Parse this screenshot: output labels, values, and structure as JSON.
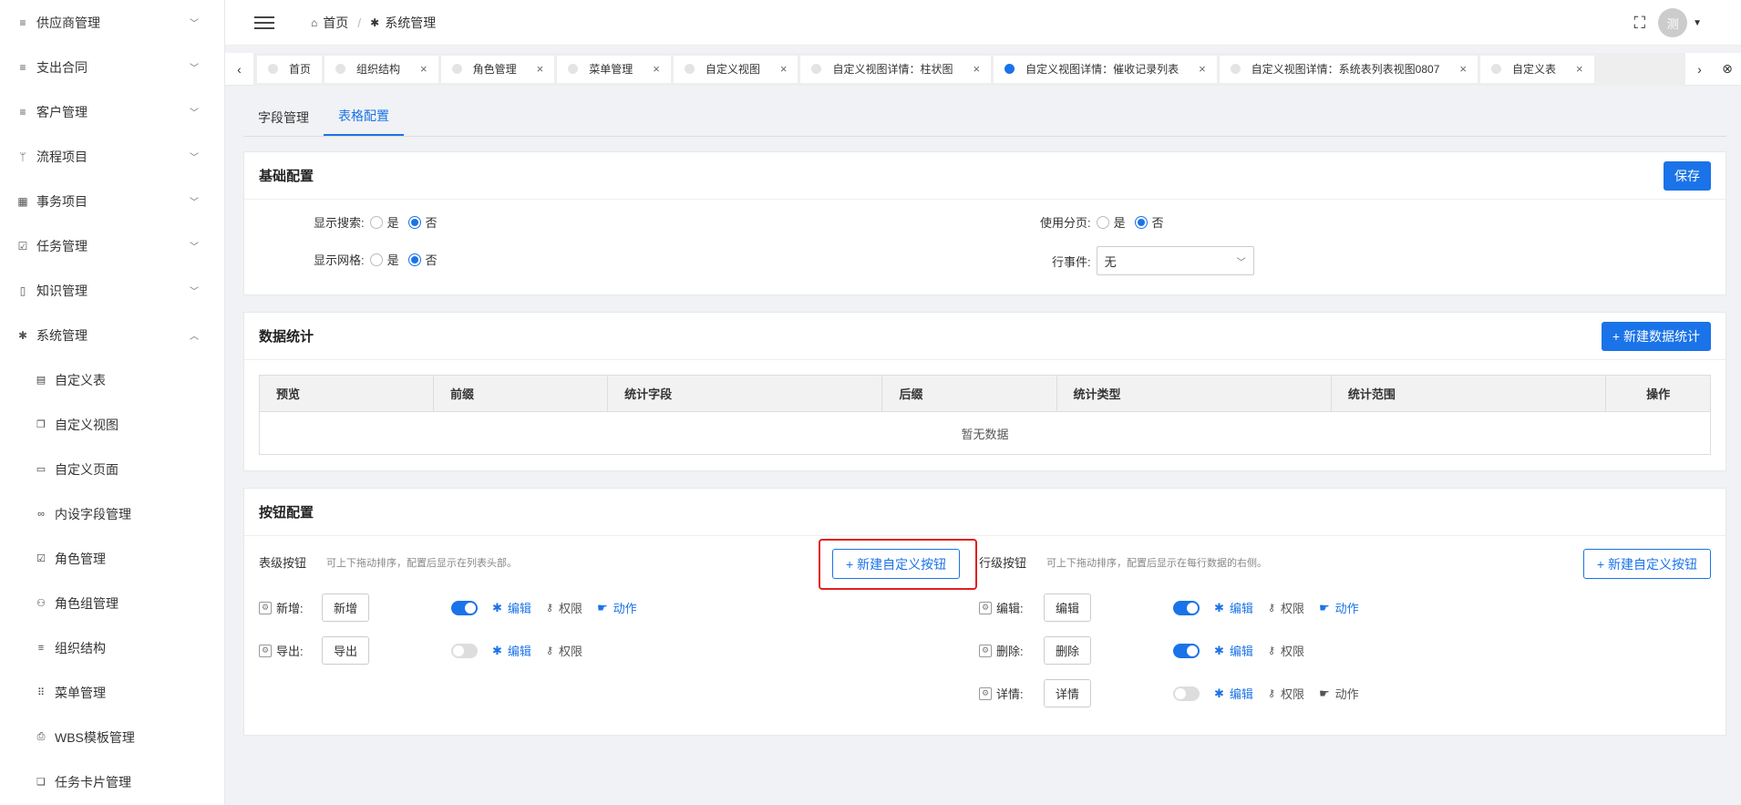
{
  "sidebar": {
    "items": [
      {
        "label": "供应商管理",
        "icon": "list-icon"
      },
      {
        "label": "支出合同",
        "icon": "list-icon"
      },
      {
        "label": "客户管理",
        "icon": "list-icon"
      },
      {
        "label": "流程项目",
        "icon": "branch-icon"
      },
      {
        "label": "事务项目",
        "icon": "grid-icon"
      },
      {
        "label": "任务管理",
        "icon": "calendar-check-icon"
      },
      {
        "label": "知识管理",
        "icon": "book-icon"
      },
      {
        "label": "系统管理",
        "icon": "gear-icon"
      }
    ],
    "sub_items": [
      {
        "label": "自定义表",
        "icon": "doc-icon"
      },
      {
        "label": "自定义视图",
        "icon": "copy-icon"
      },
      {
        "label": "自定义页面",
        "icon": "window-icon"
      },
      {
        "label": "内设字段管理",
        "icon": "link-icon"
      },
      {
        "label": "角色管理",
        "icon": "check-square-icon"
      },
      {
        "label": "角色组管理",
        "icon": "users-icon"
      },
      {
        "label": "组织结构",
        "icon": "list-icon"
      },
      {
        "label": "菜单管理",
        "icon": "dots-grid-icon"
      },
      {
        "label": "WBS模板管理",
        "icon": "print-icon"
      },
      {
        "label": "任务卡片管理",
        "icon": "cards-icon"
      }
    ]
  },
  "header": {
    "breadcrumb_home": "首页",
    "breadcrumb_current": "系统管理",
    "avatar_text": "测"
  },
  "tabs": [
    {
      "label": "首页",
      "active": false,
      "closable": false
    },
    {
      "label": "组织结构",
      "active": false,
      "closable": true
    },
    {
      "label": "角色管理",
      "active": false,
      "closable": true
    },
    {
      "label": "菜单管理",
      "active": false,
      "closable": true
    },
    {
      "label": "自定义视图",
      "active": false,
      "closable": true
    },
    {
      "label": "自定义视图详情：柱状图",
      "active": false,
      "closable": true
    },
    {
      "label": "自定义视图详情：催收记录列表",
      "active": true,
      "closable": true
    },
    {
      "label": "自定义视图详情：系统表列表视图0807",
      "active": false,
      "closable": true
    },
    {
      "label": "自定义表",
      "active": false,
      "closable": true
    }
  ],
  "subtabs": {
    "fields": "字段管理",
    "table_config": "表格配置"
  },
  "basic": {
    "title": "基础配置",
    "save": "保存",
    "show_search": "显示搜索:",
    "show_grid": "显示网格:",
    "use_paging": "使用分页:",
    "row_event": "行事件:",
    "row_event_value": "无",
    "yes": "是",
    "no": "否"
  },
  "stats": {
    "title": "数据统计",
    "new_button": "+ 新建数据统计",
    "columns": [
      "预览",
      "前缀",
      "统计字段",
      "后缀",
      "统计类型",
      "统计范围",
      "操作"
    ],
    "empty": "暂无数据"
  },
  "buttons": {
    "title": "按钮配置",
    "table_level": "表级按钮",
    "table_hint": "可上下拖动排序，配置后显示在列表头部。",
    "row_level": "行级按钮",
    "row_hint": "可上下拖动排序，配置后显示在每行数据的右侧。",
    "new_custom": "+ 新建自定义按钮",
    "edit": "编辑",
    "permission": "权限",
    "action": "动作",
    "table_buttons": [
      {
        "label": "新增:",
        "button": "新增",
        "enabled": true,
        "has_action": true
      },
      {
        "label": "导出:",
        "button": "导出",
        "enabled": false,
        "has_action": false
      }
    ],
    "row_buttons": [
      {
        "label": "编辑:",
        "button": "编辑",
        "enabled": true,
        "has_action": true
      },
      {
        "label": "删除:",
        "button": "删除",
        "enabled": true,
        "has_action": false
      },
      {
        "label": "详情:",
        "button": "详情",
        "enabled": false,
        "has_action": true
      }
    ]
  }
}
